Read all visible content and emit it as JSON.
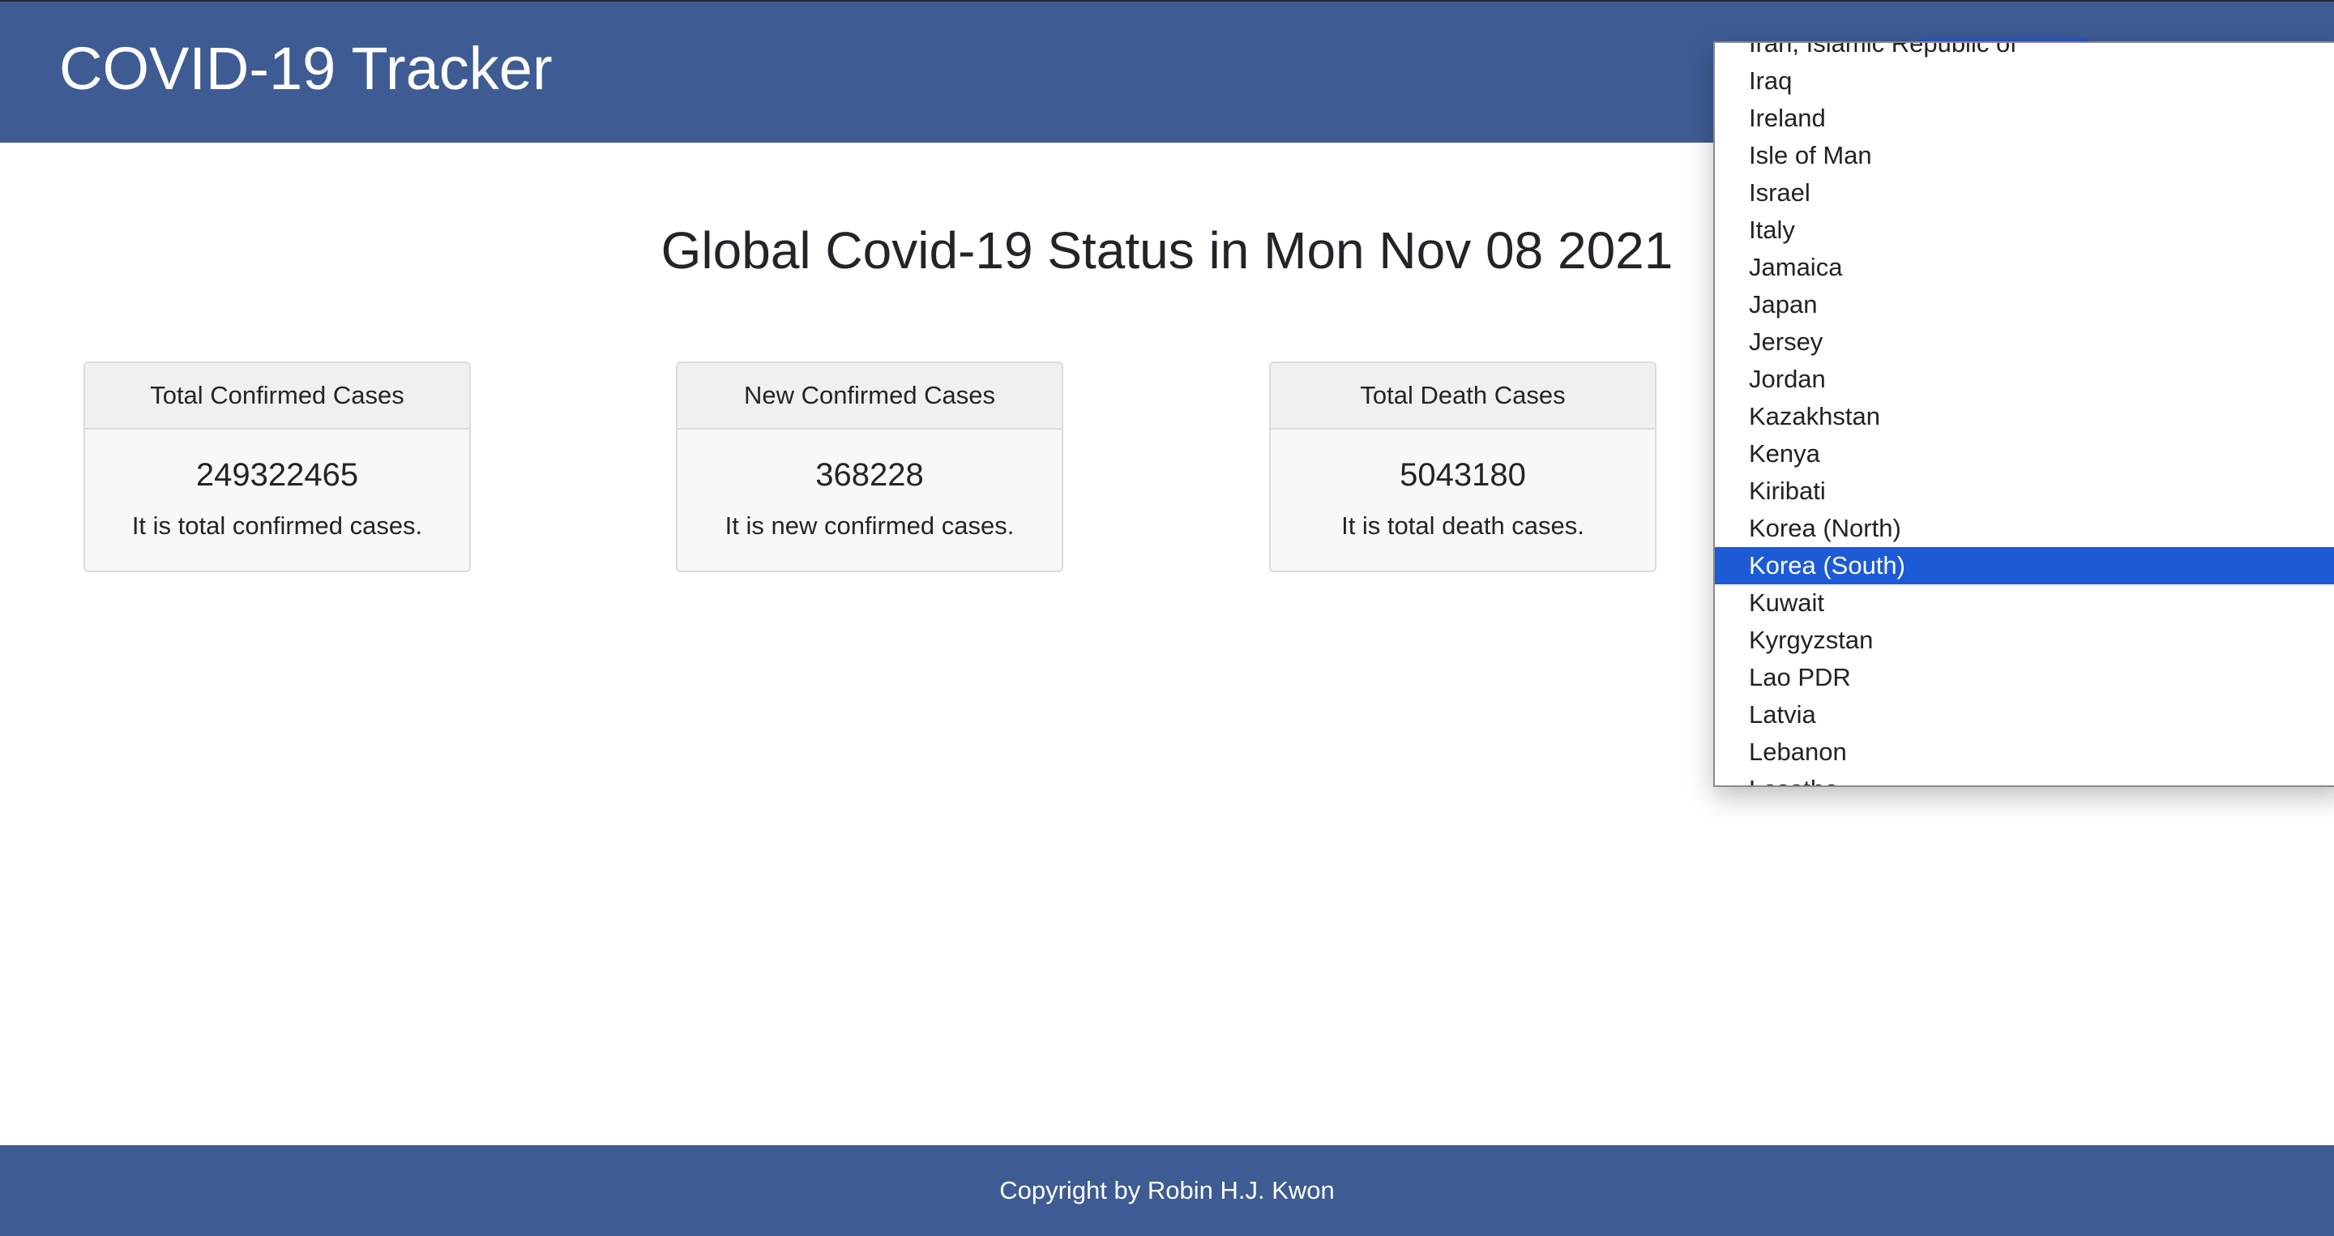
{
  "header": {
    "brand": "COVID-19 Tracker"
  },
  "main": {
    "title": "Global Covid-19 Status in Mon Nov 08 2021",
    "cards": [
      {
        "header": "Total Confirmed Cases",
        "value": "249322465",
        "text": "It is total confirmed cases."
      },
      {
        "header": "New Confirmed Cases",
        "value": "368228",
        "text": "It is new confirmed cases."
      },
      {
        "header": "Total Death Cases",
        "value": "5043180",
        "text": "It is total death cases."
      }
    ]
  },
  "dropdown": {
    "selected": "Korea (South)",
    "options": [
      "Iran, Islamic Republic of",
      "Iraq",
      "Ireland",
      "Isle of Man",
      "Israel",
      "Italy",
      "Jamaica",
      "Japan",
      "Jersey",
      "Jordan",
      "Kazakhstan",
      "Kenya",
      "Kiribati",
      "Korea (North)",
      "Korea (South)",
      "Kuwait",
      "Kyrgyzstan",
      "Lao PDR",
      "Latvia",
      "Lebanon",
      "Lesotho"
    ]
  },
  "footer": {
    "text": "Copyright by Robin H.J. Kwon"
  },
  "colors": {
    "header": "#3f5b93",
    "highlight": "#1d5bd6"
  }
}
